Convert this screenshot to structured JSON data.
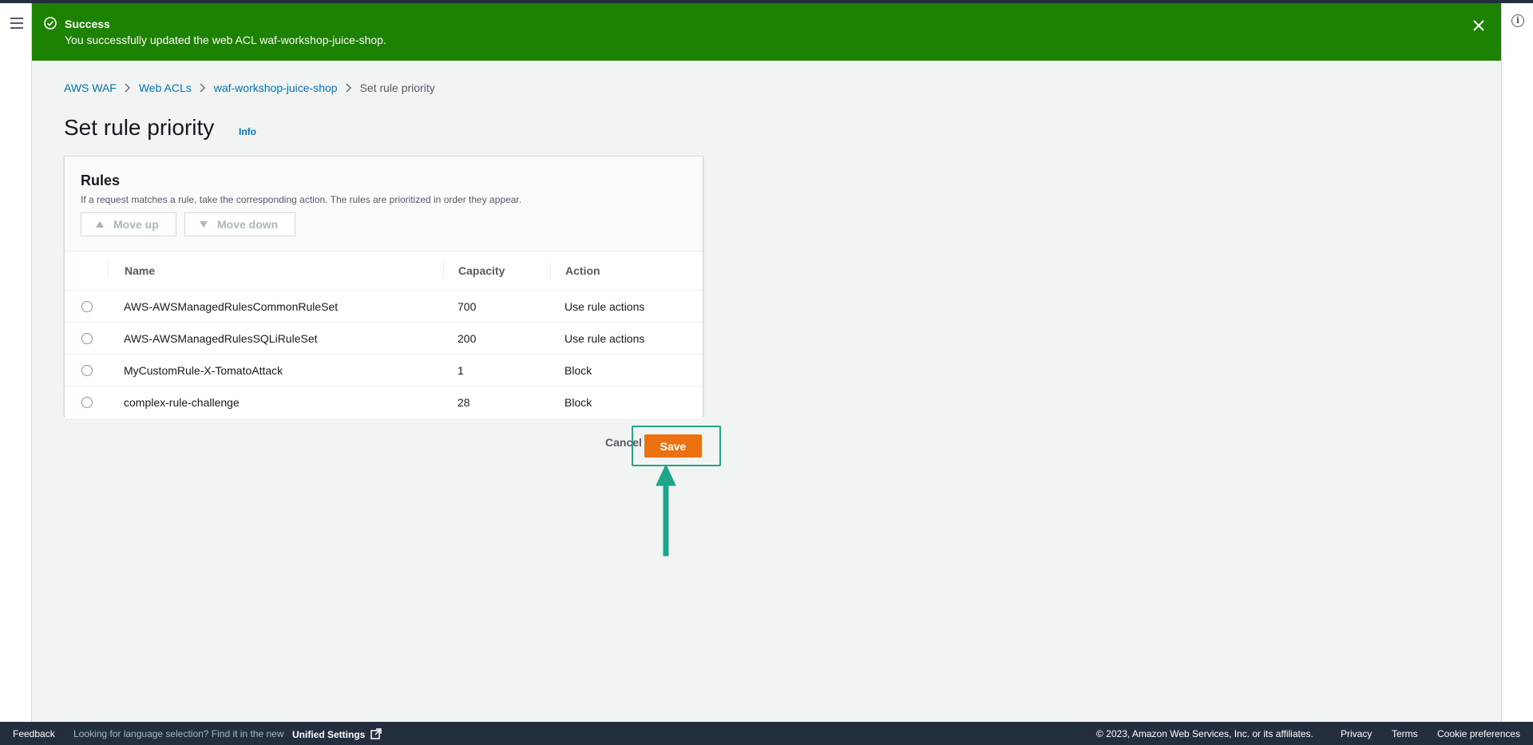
{
  "flash": {
    "title": "Success",
    "message": "You successfully updated the web ACL waf-workshop-juice-shop."
  },
  "breadcrumb": {
    "items": [
      "AWS WAF",
      "Web ACLs",
      "waf-workshop-juice-shop"
    ],
    "current": "Set rule priority"
  },
  "page": {
    "title": "Set rule priority",
    "info_label": "Info"
  },
  "rules_panel": {
    "title": "Rules",
    "description": "If a request matches a rule, take the corresponding action. The rules are prioritized in order they appear.",
    "move_up_label": "Move up",
    "move_down_label": "Move down",
    "columns": [
      "Name",
      "Capacity",
      "Action"
    ],
    "rows": [
      {
        "name": "AWS-AWSManagedRulesCommonRuleSet",
        "capacity": "700",
        "action": "Use rule actions"
      },
      {
        "name": "AWS-AWSManagedRulesSQLiRuleSet",
        "capacity": "200",
        "action": "Use rule actions"
      },
      {
        "name": "MyCustomRule-X-TomatoAttack",
        "capacity": "1",
        "action": "Block"
      },
      {
        "name": "complex-rule-challenge",
        "capacity": "28",
        "action": "Block"
      }
    ]
  },
  "actions": {
    "cancel_label": "Cancel",
    "save_label": "Save"
  },
  "footer": {
    "feedback": "Feedback",
    "language_note": "Looking for language selection? Find it in the new",
    "unified_settings": "Unified Settings",
    "copyright": "© 2023, Amazon Web Services, Inc. or its affiliates.",
    "privacy": "Privacy",
    "terms": "Terms",
    "cookie_preferences": "Cookie preferences"
  },
  "colors": {
    "success": "#1d8102",
    "primary_button": "#ec7211",
    "link": "#0073bb",
    "annotation": "#1ea68a",
    "footer_bg": "#232f3e"
  }
}
